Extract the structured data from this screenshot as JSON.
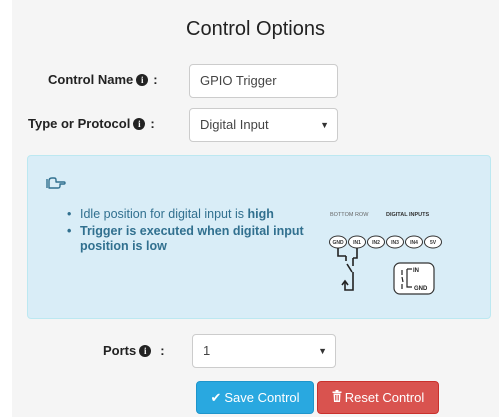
{
  "form": {
    "title": "Control Options",
    "control_name": {
      "label": "Control Name",
      "value": "GPIO Trigger"
    },
    "type_protocol": {
      "label": "Type or Protocol",
      "value": "Digital Input"
    },
    "ports": {
      "label": "Ports",
      "value": "1"
    },
    "colon": ":"
  },
  "info": {
    "bullet1_pre": "Idle position for digital input is ",
    "bullet1_bold": "high",
    "bullet2": "Trigger is executed when digital input position is low",
    "diagram": {
      "bottom_row_label": "BOTTOM ROW",
      "digital_inputs_label": "DIGITAL INPUTS",
      "pins": [
        "GND",
        "IN1",
        "IN2",
        "IN3",
        "IN4",
        "5V"
      ],
      "in_label": "IN",
      "gnd_label": "GND"
    }
  },
  "buttons": {
    "save": "Save Control",
    "reset": "Reset Control"
  },
  "colors": {
    "info_bg": "#d9edf7",
    "info_text": "#31708f",
    "save": "#29a8e0",
    "reset": "#d9534f"
  }
}
